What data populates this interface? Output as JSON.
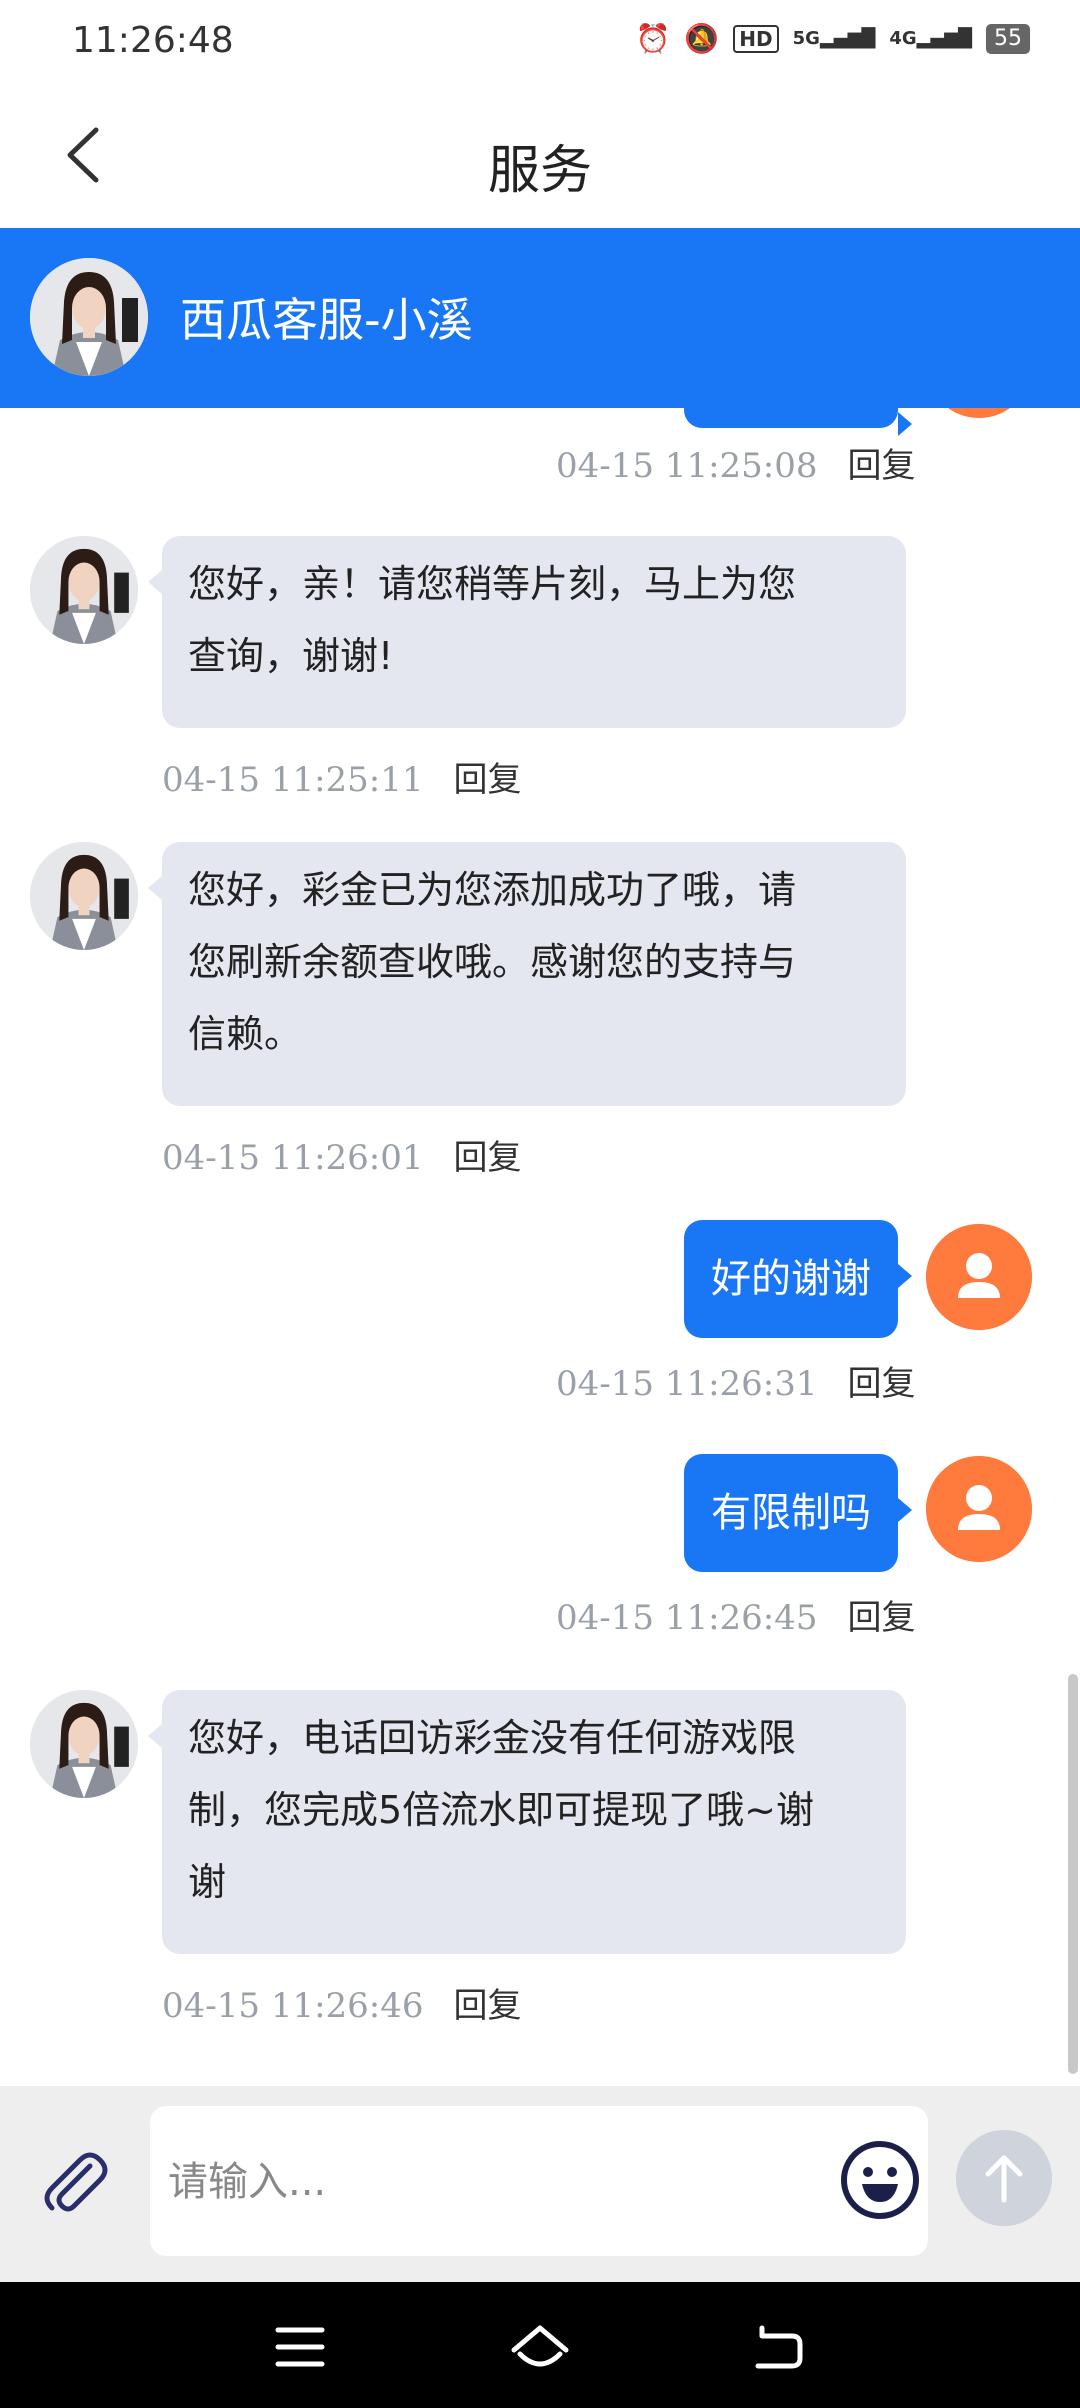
{
  "status_bar": {
    "time": "11:26:48",
    "network_1": "HD",
    "signal_1": "5G",
    "signal_2": "4G",
    "battery": "55"
  },
  "title_bar": {
    "title": "服务"
  },
  "agent": {
    "name": "西瓜客服-小溪"
  },
  "messages": [
    {
      "direction": "out",
      "text": "",
      "time": "04-15 11:25:08",
      "reply_label": "回复"
    },
    {
      "direction": "in",
      "lines": [
        "您好，亲！请您稍等片刻，马上为您",
        "查询，谢谢!"
      ],
      "time": "04-15 11:25:11",
      "reply_label": "回复"
    },
    {
      "direction": "in",
      "lines": [
        "您好，彩金已为您添加成功了哦，请",
        "您刷新余额查收哦。感谢您的支持与",
        "信赖。"
      ],
      "time": "04-15 11:26:01",
      "reply_label": "回复"
    },
    {
      "direction": "out",
      "text": "好的谢谢",
      "time": "04-15 11:26:31",
      "reply_label": "回复"
    },
    {
      "direction": "out",
      "text": "有限制吗",
      "time": "04-15 11:26:45",
      "reply_label": "回复"
    },
    {
      "direction": "in",
      "lines": [
        "您好，电话回访彩金没有任何游戏限",
        "制，您完成5倍流水即可提现了哦~谢",
        "谢"
      ],
      "time": "04-15 11:26:46",
      "reply_label": "回复"
    }
  ],
  "input": {
    "placeholder": "请输入..."
  },
  "colors": {
    "brand_blue": "#1976f5",
    "user_avatar": "#ff7a3d",
    "incoming_bubble": "#e4e7ef"
  },
  "icons": {
    "back": "chevron-left-icon",
    "attach": "paperclip-icon",
    "emoji": "smiley-icon",
    "send": "arrow-up-icon",
    "nav_menu": "menu-icon",
    "nav_home": "home-icon",
    "nav_back": "back-icon"
  }
}
